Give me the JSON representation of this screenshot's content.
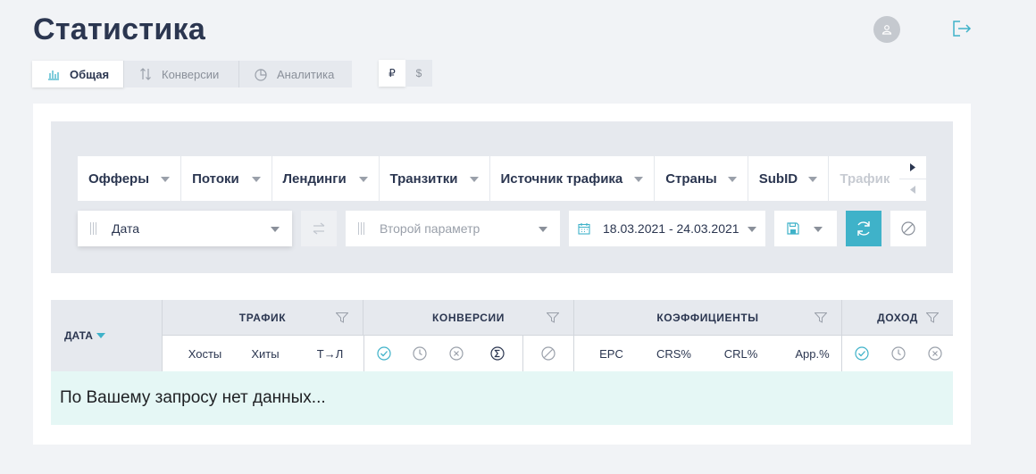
{
  "header": {
    "title": "Статистика"
  },
  "tabs": [
    {
      "label": "Общая",
      "icon": "bar-chart-icon",
      "active": true
    },
    {
      "label": "Конверсии",
      "icon": "sort-arrows-icon",
      "active": false
    },
    {
      "label": "Аналитика",
      "icon": "pie-chart-icon",
      "active": false
    }
  ],
  "currency": {
    "options": [
      "₽",
      "$"
    ],
    "selected": "₽"
  },
  "grouping": {
    "items": [
      "Офферы",
      "Потоки",
      "Лендинги",
      "Транзитки",
      "Источник трафика",
      "Страны",
      "SubID",
      "Трафик"
    ]
  },
  "filters": {
    "first_param": "Дата",
    "second_param_placeholder": "Второй параметр",
    "date_range": "18.03.2021 - 24.03.2021"
  },
  "table": {
    "date_header": "ДАТА",
    "groups": {
      "traffic": "ТРАФИК",
      "conversions": "КОНВЕРСИИ",
      "coefficients": "КОЭФФИЦИЕНТЫ",
      "income": "ДОХОД"
    },
    "columns": {
      "hosts": "Хосты",
      "hits": "Хиты",
      "tl": "Т→Л",
      "epc": "EPC",
      "crs": "CRS%",
      "crl": "CRL%",
      "app": "App.%"
    },
    "empty_message": "По Вашему запросу нет данных..."
  },
  "colors": {
    "accent": "#3fb2c9",
    "title": "#2b3650",
    "empty_row_bg": "#e5f7f5"
  }
}
